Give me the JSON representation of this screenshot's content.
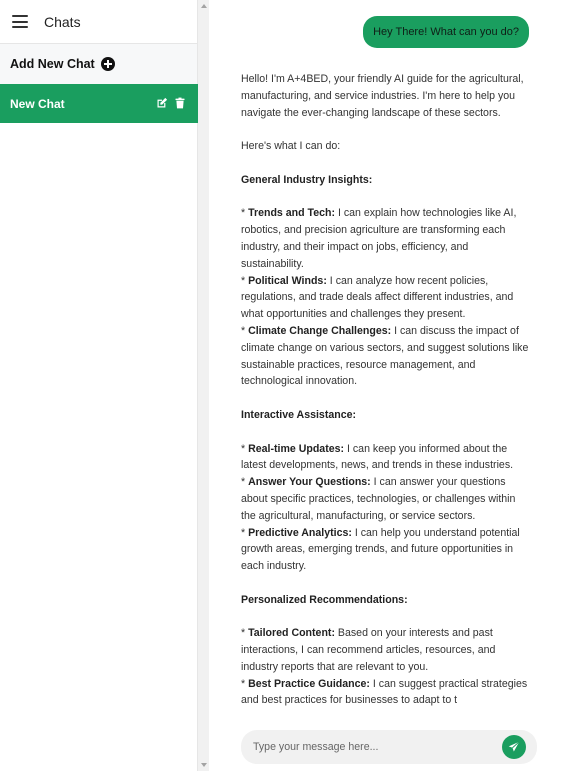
{
  "sidebar": {
    "title": "Chats",
    "add_label": "Add New Chat",
    "chats": [
      {
        "label": "New Chat"
      }
    ]
  },
  "conversation": {
    "user_message": "Hey There! What can you do?",
    "bot": {
      "intro": "Hello! I'm A+4BED, your friendly AI guide for the agricultural, manufacturing, and service industries. I'm here to help you navigate the ever-changing landscape of these sectors.",
      "lead": "Here's what I can do:",
      "sections": [
        {
          "heading": "General Industry Insights:",
          "items": [
            {
              "title": "Trends and Tech:",
              "text": " I can explain how technologies like AI, robotics, and precision agriculture are transforming each industry, and their impact on jobs, efficiency, and sustainability."
            },
            {
              "title": "Political Winds:",
              "text": "  I can analyze how recent policies, regulations, and trade deals affect different industries, and what opportunities and challenges they present."
            },
            {
              "title": "Climate Change Challenges:",
              "text": "  I can discuss the impact of climate change on various sectors, and suggest solutions like sustainable practices, resource management, and technological innovation."
            }
          ]
        },
        {
          "heading": "Interactive Assistance:",
          "items": [
            {
              "title": "Real-time Updates:",
              "text": "  I can keep you informed about the latest developments, news, and trends in these industries."
            },
            {
              "title": "Answer Your Questions:",
              "text": "  I can answer your questions about specific practices, technologies, or challenges within the agricultural, manufacturing, or service sectors."
            },
            {
              "title": "Predictive Analytics:",
              "text": " I can help you understand potential growth areas, emerging trends, and future opportunities in each industry."
            }
          ]
        },
        {
          "heading": "Personalized Recommendations:",
          "items": [
            {
              "title": "Tailored Content:",
              "text": "  Based on your interests and past interactions, I can recommend articles, resources, and industry reports that are relevant to you."
            },
            {
              "title": "Best Practice Guidance:",
              "text": "  I can suggest practical strategies and best practices for businesses to adapt to t"
            }
          ]
        }
      ]
    }
  },
  "composer": {
    "placeholder": "Type your message here..."
  },
  "colors": {
    "accent": "#1a9e5f",
    "input_bg": "#f1f1f1"
  },
  "icons": {
    "menu": "hamburger-icon",
    "add": "plus-circle-icon",
    "edit": "edit-icon",
    "delete": "trash-icon",
    "send": "send-icon"
  }
}
